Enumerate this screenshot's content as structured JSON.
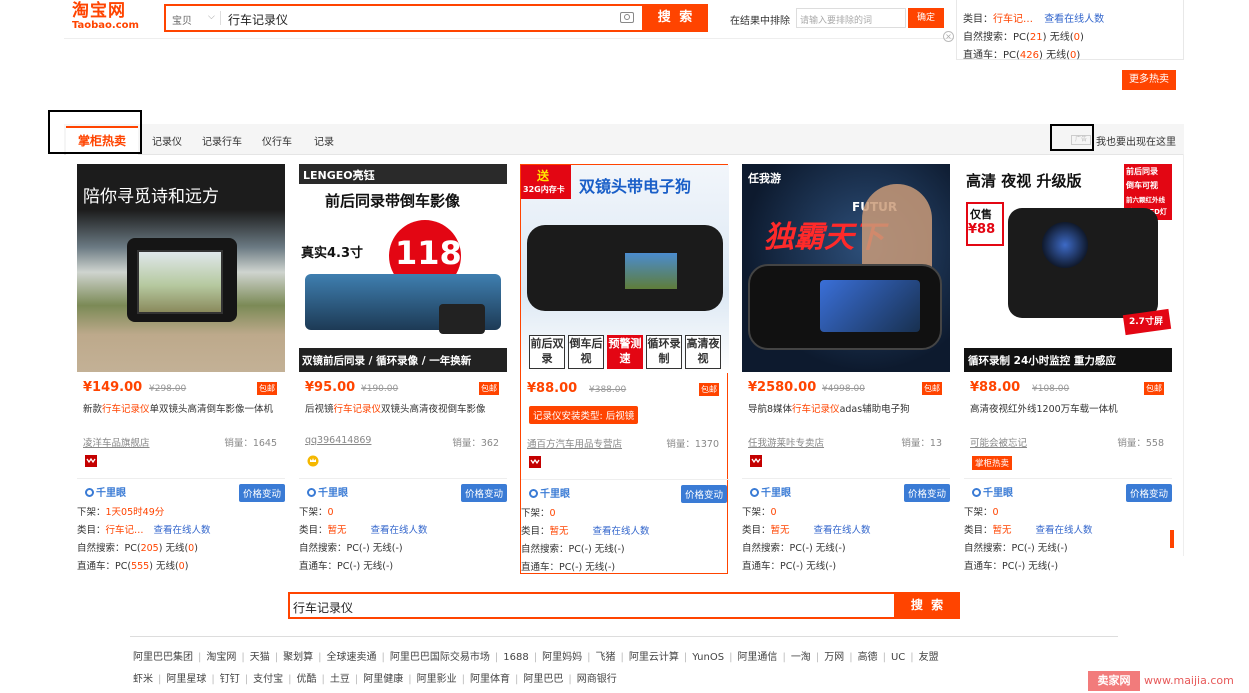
{
  "header": {
    "logo_cn": "淘宝网",
    "logo_en": "Taobao.com",
    "search_category": "宝贝",
    "search_query": "行车记录仪",
    "search_button": "搜 索",
    "rank_label": "在结果中排除",
    "rank_placeholder": "请输入要排除的词",
    "rank_button": "确定"
  },
  "side_panel": {
    "line1": "类目：行车记…  查看在线人数",
    "line1_prefix": "类目：",
    "line1_cat": "行车记…",
    "line1_link": "查看在线人数",
    "line2_prefix": "自然搜索：PC(",
    "line2_pc": "21",
    "line2_mid": ") 无线(",
    "line2_wx": "0",
    "line2_end": ")",
    "line3_prefix": "直通车：PC(",
    "line3_pc": "426",
    "line3_mid": ") 无线(",
    "line3_wx": "0",
    "line3_end": ")",
    "more_button": "更多热卖"
  },
  "tabs": {
    "active": "掌柜热卖",
    "items": [
      "记录仪",
      "记录行车",
      "仪行车",
      "记录"
    ],
    "ad_mini": "广告",
    "ad_text": "我也要出现在这里"
  },
  "products": [
    {
      "price": "¥149.00",
      "old_price": "¥298.00",
      "baoyou": "包邮",
      "title_pre": "新款",
      "title_hl": "行车记录仪",
      "title_post": "单双镜头高清倒车影像一体机",
      "shop": "凌洋车品旗舰店",
      "sales": "销量：1645",
      "img_text": "陪你寻觅诗和远方",
      "qly": "千里眼",
      "price_change": "价格变动",
      "xiajia_label": "下架：",
      "xiajia": "1天05时49分",
      "cat_label": "类目：",
      "cat": "行车记…",
      "online": "查看在线人数",
      "natural_label": "自然搜索：PC(",
      "natural_pc": "205",
      "natural_mid": ") 无线(",
      "natural_wx": "0",
      "natural_end": ")",
      "ztc_label": "直通车：PC(",
      "ztc_pc": "555",
      "ztc_mid": ") 无线(",
      "ztc_wx": "0",
      "ztc_end": ")"
    },
    {
      "price": "¥95.00",
      "old_price": "¥190.00",
      "baoyou": "包邮",
      "title_pre": "后视镜",
      "title_hl": "行车记录仪",
      "title_post": "双镜头高清夜视倒车影像",
      "shop": "qq396414869",
      "sales": "销量：362",
      "img_brand": "LENGEO亮钰",
      "img_text": "前后同录带倒车影像",
      "img_price": "118",
      "img_size": "真实4.3寸",
      "img_bottom": "双镜前后同录 / 循环录像 / 一年换新",
      "qly": "千里眼",
      "price_change": "价格变动",
      "xiajia_label": "下架：",
      "xiajia": "0",
      "cat_label": "类目：",
      "cat": "暂无",
      "online": "查看在线人数",
      "natural_label": "自然搜索：PC(",
      "natural_pc": "-",
      "natural_mid": ") 无线(",
      "natural_wx": "-",
      "natural_end": ")",
      "ztc_label": "直通车：PC(",
      "ztc_pc": "-",
      "ztc_mid": ") 无线(",
      "ztc_wx": "-",
      "ztc_end": ")"
    },
    {
      "price": "¥88.00",
      "old_price": "¥388.00",
      "baoyou": "包邮",
      "tag": "记录仪安装类型: 后视镜",
      "shop": "通百方汽车用品专营店",
      "sales": "销量：1370",
      "img_send": "送",
      "img_send_sub": "32G内存卡",
      "img_text": "双镜头带电子狗",
      "img_feats": [
        "前后双录",
        "倒车后视",
        "预警测速",
        "循环录制",
        "高清夜视"
      ],
      "qly": "千里眼",
      "price_change": "价格变动",
      "xiajia_label": "下架：",
      "xiajia": "0",
      "cat_label": "类目：",
      "cat": "暂无",
      "online": "查看在线人数",
      "natural_label": "自然搜索：PC(",
      "natural_pc": "-",
      "natural_mid": ") 无线(",
      "natural_wx": "-",
      "natural_end": ")",
      "ztc_label": "直通车：PC(",
      "ztc_pc": "-",
      "ztc_mid": ") 无线(",
      "ztc_wx": "-",
      "ztc_end": ")"
    },
    {
      "price": "¥2580.00",
      "old_price": "¥4998.00",
      "baoyou": "包邮",
      "title_pre": "导航8媒体",
      "title_hl": "行车记录仪",
      "title_post": "adas辅助电子狗",
      "shop": "任我游莱咔专卖店",
      "sales": "销量：13",
      "img_brand": "任我游",
      "img_text": "独霸天下",
      "img_sub": "FUTUR",
      "qly": "千里眼",
      "price_change": "价格变动",
      "xiajia_label": "下架：",
      "xiajia": "0",
      "cat_label": "类目：",
      "cat": "暂无",
      "online": "查看在线人数",
      "natural_label": "自然搜索：PC(",
      "natural_pc": "-",
      "natural_mid": ") 无线(",
      "natural_wx": "-",
      "natural_end": ")",
      "ztc_label": "直通车：PC(",
      "ztc_pc": "-",
      "ztc_mid": ") 无线(",
      "ztc_wx": "-",
      "ztc_end": ")"
    },
    {
      "price": "¥88.00",
      "old_price": "¥108.00",
      "baoyou": "包邮",
      "title_pre": "高清夜视红外线1200万车载一体机",
      "title_hl": "",
      "title_post": "",
      "shop": "可能会被忘记",
      "sales": "销量：558",
      "tag2": "掌柜热卖",
      "img_text": "高清 夜视 升级版",
      "img_price_label": "仅售",
      "img_price": "¥88",
      "img_bottom": "循环录制  24小时监控  重力感应",
      "img_side": [
        "前后同录",
        "倒车可视",
        "前六颗红外线",
        "后4颗LED灯"
      ],
      "img_size": "2.7寸屏",
      "qly": "千里眼",
      "price_change": "价格变动",
      "xiajia_label": "下架：",
      "xiajia": "0",
      "cat_label": "类目：",
      "cat": "暂无",
      "online": "查看在线人数",
      "natural_label": "自然搜索：PC(",
      "natural_pc": "-",
      "natural_mid": ") 无线(",
      "natural_wx": "-",
      "natural_end": ")",
      "ztc_label": "直通车：PC(",
      "ztc_pc": "-",
      "ztc_mid": ") 无线(",
      "ztc_wx": "-",
      "ztc_end": ")"
    }
  ],
  "bottom_search": {
    "query": "行车记录仪",
    "button": "搜 索"
  },
  "footer": {
    "row1": [
      "阿里巴巴集团",
      "淘宝网",
      "天猫",
      "聚划算",
      "全球速卖通",
      "阿里巴巴国际交易市场",
      "1688",
      "阿里妈妈",
      "飞猪",
      "阿里云计算",
      "YunOS",
      "阿里通信",
      "一淘",
      "万网",
      "高德",
      "UC",
      "友盟"
    ],
    "row2": [
      "虾米",
      "阿里星球",
      "钉钉",
      "支付宝",
      "优酷",
      "土豆",
      "阿里健康",
      "阿里影业",
      "阿里体育",
      "阿里巴巴",
      "网商银行"
    ]
  },
  "watermark": {
    "box": "卖家网",
    "url": "www.maijia.com"
  }
}
